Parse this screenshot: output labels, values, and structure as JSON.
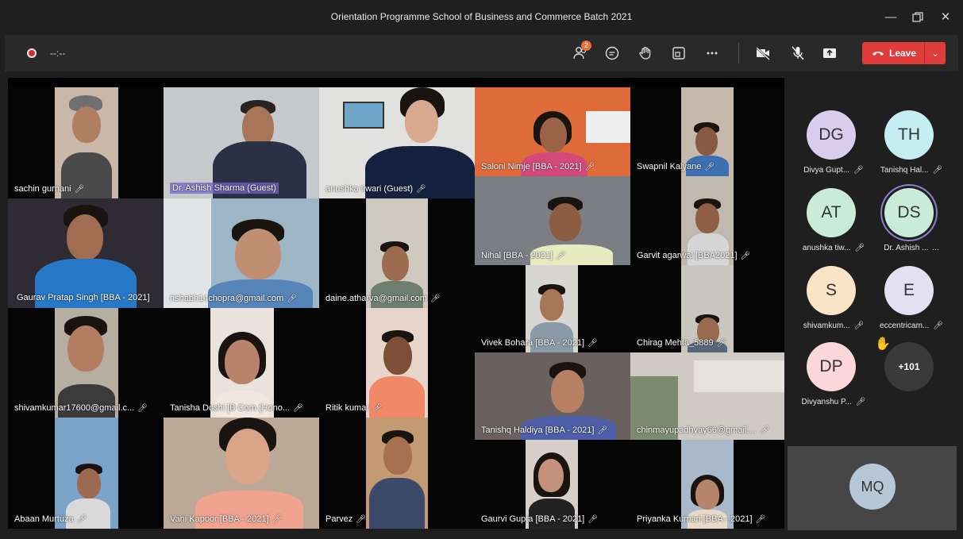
{
  "window": {
    "title": "Orientation Programme School of Business and Commerce Batch 2021"
  },
  "toolbar": {
    "timer": "--:--",
    "participants_badge": "2",
    "leave_label": "Leave",
    "colors": {
      "leave": "#e03c3c",
      "badge": "#e8703a",
      "record": "#d32f2f"
    }
  },
  "tiles": [
    {
      "name": "sachin gurnani"
    },
    {
      "name": "Dr. Ashish Sharma (Guest)"
    },
    {
      "name": "anushka tiwari (Guest)"
    },
    {
      "name": "Saloni Nimje [BBA - 2021]"
    },
    {
      "name": "Swapnil Kalyane"
    },
    {
      "name": "Gaurav Pratap Singh [BBA - 2021]"
    },
    {
      "name": "rishabh14chopra@gmail.com"
    },
    {
      "name": "daine.atharva@gmail.com"
    },
    {
      "name": "Nihal [BBA - 2021]"
    },
    {
      "name": "Garvit agarwal [BBA2021]"
    },
    {
      "name": "Vivek Bohara [BBA - 2021]"
    },
    {
      "name": "Chirag Mehta_5889"
    },
    {
      "name": "shivamkumar17600@gmail.c..."
    },
    {
      "name": "Tanisha Doshi [B Com (Hono..."
    },
    {
      "name": "Ritik kumar"
    },
    {
      "name": "Tanishq Haldiya [BBA - 2021]"
    },
    {
      "name": "chinmayupadhyay66@gmail...."
    },
    {
      "name": "Abaan Murtuza"
    },
    {
      "name": "Vani Kapoor [BBA - 2021]"
    },
    {
      "name": "Parvez"
    },
    {
      "name": "Gaurvi Gupta [BBA - 2021]"
    },
    {
      "name": "Priyanka Kumari [BBA - 2021]"
    }
  ],
  "panel": [
    {
      "initials": "DG",
      "name": "Divya Gupt...",
      "color": "#d9cdee"
    },
    {
      "initials": "TH",
      "name": "Tanishq Hal...",
      "color": "#c5eef2"
    },
    {
      "initials": "AT",
      "name": "anushka tiw...",
      "color": "#c9ecd9"
    },
    {
      "initials": "DS",
      "name": "Dr. Ashish ...",
      "color": "#c9ecd9",
      "more": "..."
    },
    {
      "initials": "S",
      "name": "shivamkum...",
      "color": "#fbe4c6"
    },
    {
      "initials": "E",
      "name": "eccentricam...",
      "color": "#e3e1f1"
    },
    {
      "initials": "DP",
      "name": "Divyanshu P...",
      "color": "#fbd7db"
    },
    {
      "initials": "+101",
      "name": "",
      "color": "#3a3a3a"
    }
  ],
  "spotlight": {
    "initials": "MQ",
    "color": "#b6c8d6"
  }
}
